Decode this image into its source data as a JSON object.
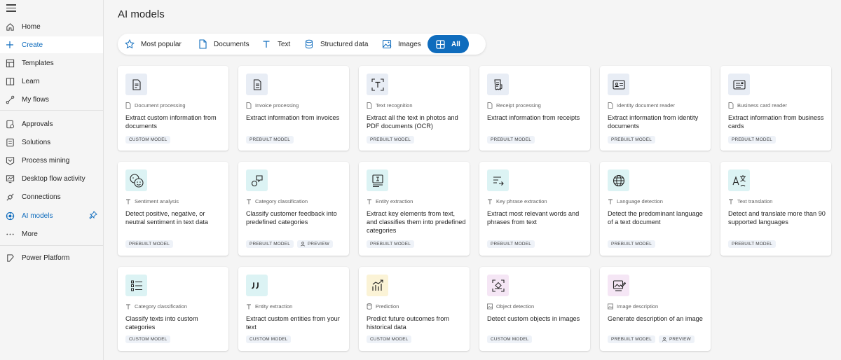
{
  "sidebar": {
    "items": [
      {
        "label": "Home",
        "icon": "home-icon"
      },
      {
        "label": "Create",
        "icon": "plus-icon"
      },
      {
        "label": "Templates",
        "icon": "templates-icon"
      },
      {
        "label": "Learn",
        "icon": "book-icon"
      },
      {
        "label": "My flows",
        "icon": "flow-icon"
      },
      {
        "label": "Approvals",
        "icon": "approvals-icon"
      },
      {
        "label": "Solutions",
        "icon": "solutions-icon"
      },
      {
        "label": "Process mining",
        "icon": "process-mining-icon"
      },
      {
        "label": "Desktop flow activity",
        "icon": "desktop-flow-icon"
      },
      {
        "label": "Connections",
        "icon": "connections-icon"
      },
      {
        "label": "AI models",
        "icon": "ai-models-icon"
      },
      {
        "label": "More",
        "icon": "more-icon"
      },
      {
        "label": "Power Platform",
        "icon": "power-platform-icon"
      }
    ]
  },
  "page": {
    "title": "AI models"
  },
  "tabs": [
    {
      "label": "Most popular",
      "icon": "star-icon"
    },
    {
      "label": "Documents",
      "icon": "document-icon"
    },
    {
      "label": "Text",
      "icon": "text-icon"
    },
    {
      "label": "Structured data",
      "icon": "database-icon"
    },
    {
      "label": "Images",
      "icon": "image-icon"
    },
    {
      "label": "All",
      "icon": "grid-icon",
      "active": true
    }
  ],
  "cards": [
    {
      "type": "Document processing",
      "title": "Extract custom information from documents",
      "badges": [
        "CUSTOM MODEL"
      ],
      "icon": "document-processing-icon",
      "accent": "#e8edf5"
    },
    {
      "type": "Invoice processing",
      "title": "Extract information from invoices",
      "badges": [
        "PREBUILT MODEL"
      ],
      "icon": "invoice-icon",
      "accent": "#e8edf5"
    },
    {
      "type": "Text recognition",
      "title": "Extract all the text in photos and PDF documents (OCR)",
      "badges": [
        "PREBUILT MODEL"
      ],
      "icon": "text-recognition-icon",
      "accent": "#e8edf5"
    },
    {
      "type": "Receipt processing",
      "title": "Extract information from receipts",
      "badges": [
        "PREBUILT MODEL"
      ],
      "icon": "receipt-icon",
      "accent": "#e8edf5"
    },
    {
      "type": "Identity document reader",
      "title": "Extract information from identity documents",
      "badges": [
        "PREBUILT MODEL"
      ],
      "icon": "identity-card-icon",
      "accent": "#e8edf5"
    },
    {
      "type": "Business card reader",
      "title": "Extract information from business cards",
      "badges": [
        "PREBUILT MODEL"
      ],
      "icon": "business-card-icon",
      "accent": "#e8edf5"
    },
    {
      "type": "Sentiment analysis",
      "title": "Detect positive, negative, or neutral sentiment in text data",
      "badges": [
        "PREBUILT MODEL"
      ],
      "icon": "sentiment-icon",
      "accent": "#dcf3f4"
    },
    {
      "type": "Category classification",
      "title": "Classify customer feedback into predefined categories",
      "badges": [
        "PREBUILT MODEL",
        "PREVIEW"
      ],
      "icon": "category-icon",
      "accent": "#dcf3f4"
    },
    {
      "type": "Entity extraction",
      "title": "Extract key elements from text, and classifies them into predefined categories",
      "badges": [
        "PREBUILT MODEL"
      ],
      "icon": "entity-extraction-icon",
      "accent": "#dcf3f4"
    },
    {
      "type": "Key phrase extraction",
      "title": "Extract most relevant words and phrases from text",
      "badges": [
        "PREBUILT MODEL"
      ],
      "icon": "key-phrase-icon",
      "accent": "#dcf3f4"
    },
    {
      "type": "Language detection",
      "title": "Detect the predominant language of a text document",
      "badges": [
        "PREBUILT MODEL"
      ],
      "icon": "globe-icon",
      "accent": "#dcf3f4"
    },
    {
      "type": "Text translation",
      "title": "Detect and translate more than 90 supported languages",
      "badges": [
        "PREBUILT MODEL"
      ],
      "icon": "translate-icon",
      "accent": "#dcf3f4"
    },
    {
      "type": "Category classification",
      "title": "Classify texts into custom categories",
      "badges": [
        "CUSTOM MODEL"
      ],
      "icon": "list-icon",
      "accent": "#dcf3f4"
    },
    {
      "type": "Entity extraction",
      "title": "Extract custom entities from your text",
      "badges": [
        "CUSTOM MODEL"
      ],
      "icon": "quote-icon",
      "accent": "#dcf3f4"
    },
    {
      "type": "Prediction",
      "title": "Predict future outcomes from historical data",
      "badges": [
        "CUSTOM MODEL"
      ],
      "icon": "prediction-chart-icon",
      "accent": "#fbf3d6"
    },
    {
      "type": "Object detection",
      "title": "Detect custom objects in images",
      "badges": [
        "CUSTOM MODEL"
      ],
      "icon": "object-detection-icon",
      "accent": "#f5e6f5"
    },
    {
      "type": "Image description",
      "title": "Generate description of an image",
      "badges": [
        "PREBUILT MODEL",
        "PREVIEW"
      ],
      "icon": "image-description-icon",
      "accent": "#f5e6f5"
    }
  ]
}
